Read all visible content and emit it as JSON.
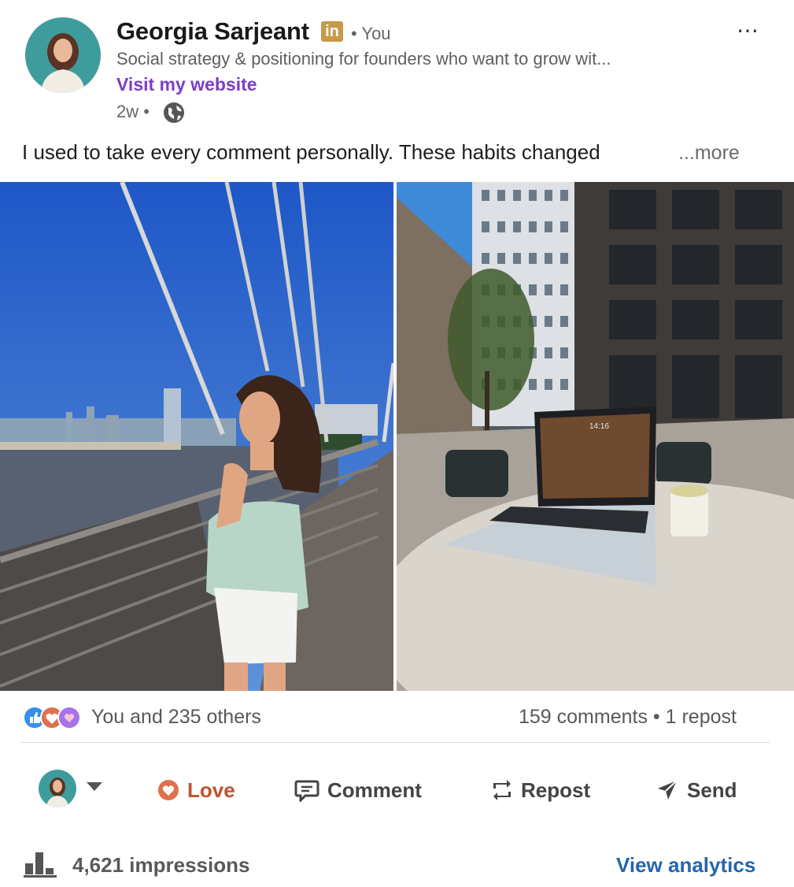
{
  "author": {
    "name": "Georgia Sarjeant",
    "badge": "in",
    "relation": "• You",
    "headline": "Social strategy & positioning for founders who want to grow wit...",
    "website_label": "Visit my website",
    "time": "2w •",
    "visibility_icon": "globe-icon"
  },
  "menu_icon": "⋯",
  "post": {
    "text": "I used to take every comment personally. These habits changed",
    "more_label": "...more"
  },
  "photos": [
    {
      "name": "bridge-photo",
      "clock": ""
    },
    {
      "name": "laptop-photo",
      "clock": "14:16"
    }
  ],
  "social": {
    "reactions_text": "You and 235 others",
    "reaction_icons": [
      "like-icon",
      "love-icon",
      "support-icon"
    ],
    "comments_text": "159 comments • 1 repost"
  },
  "actions": {
    "love": "Love",
    "comment": "Comment",
    "repost": "Repost",
    "send": "Send"
  },
  "analytics": {
    "impressions": "4,621 impressions",
    "view_label": "View analytics"
  },
  "colors": {
    "accent_link": "#2565ae",
    "website": "#7b3ec6",
    "love": "#c0532e",
    "badge": "#c79a47"
  }
}
